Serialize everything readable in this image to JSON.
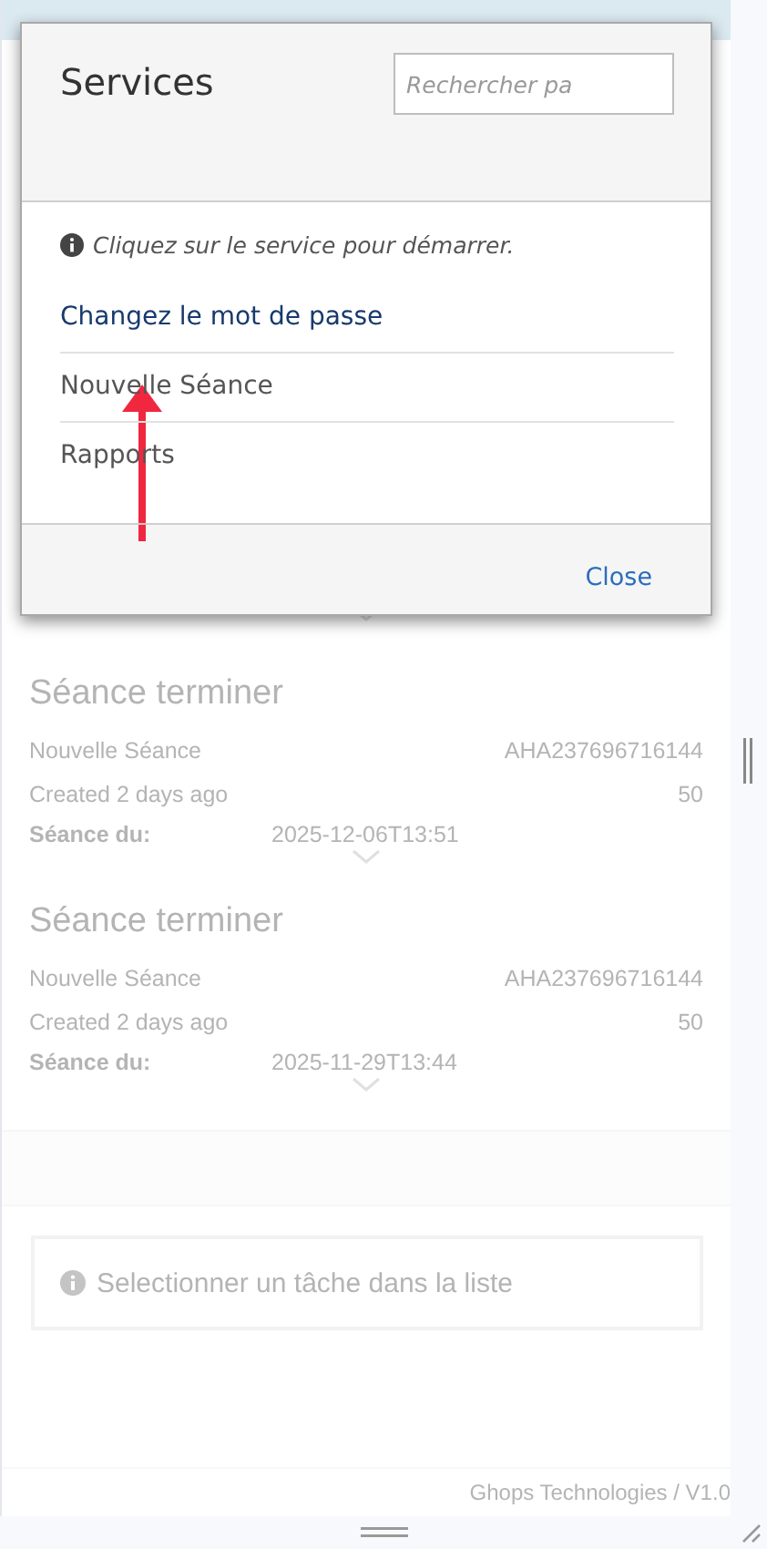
{
  "modal": {
    "title": "Services",
    "search": {
      "placeholder": "Rechercher pa"
    },
    "hint": "Cliquez sur le service pour démarrer.",
    "services": [
      {
        "label": "Changez le mot de passe",
        "highlighted": true
      },
      {
        "label": "Nouvelle Séance",
        "highlighted": false
      },
      {
        "label": "Rapports",
        "highlighted": false
      }
    ],
    "close_button": "Close"
  },
  "sessions": [
    {
      "title": "Séance terminer",
      "service": "Nouvelle Séance",
      "code": "AHA237696716144",
      "created": "Created 2 days ago",
      "score": "50",
      "date_label": "Séance du:",
      "date": "2025-12-06T13:51"
    },
    {
      "title": "Séance terminer",
      "service": "Nouvelle Séance",
      "code": "AHA237696716144",
      "created": "Created 2 days ago",
      "score": "50",
      "date_label": "Séance du:",
      "date": "2025-11-29T13:44"
    }
  ],
  "empty_state": "Selectionner un tâche dans la liste",
  "footer": "Ghops Technologies / V1.0"
}
